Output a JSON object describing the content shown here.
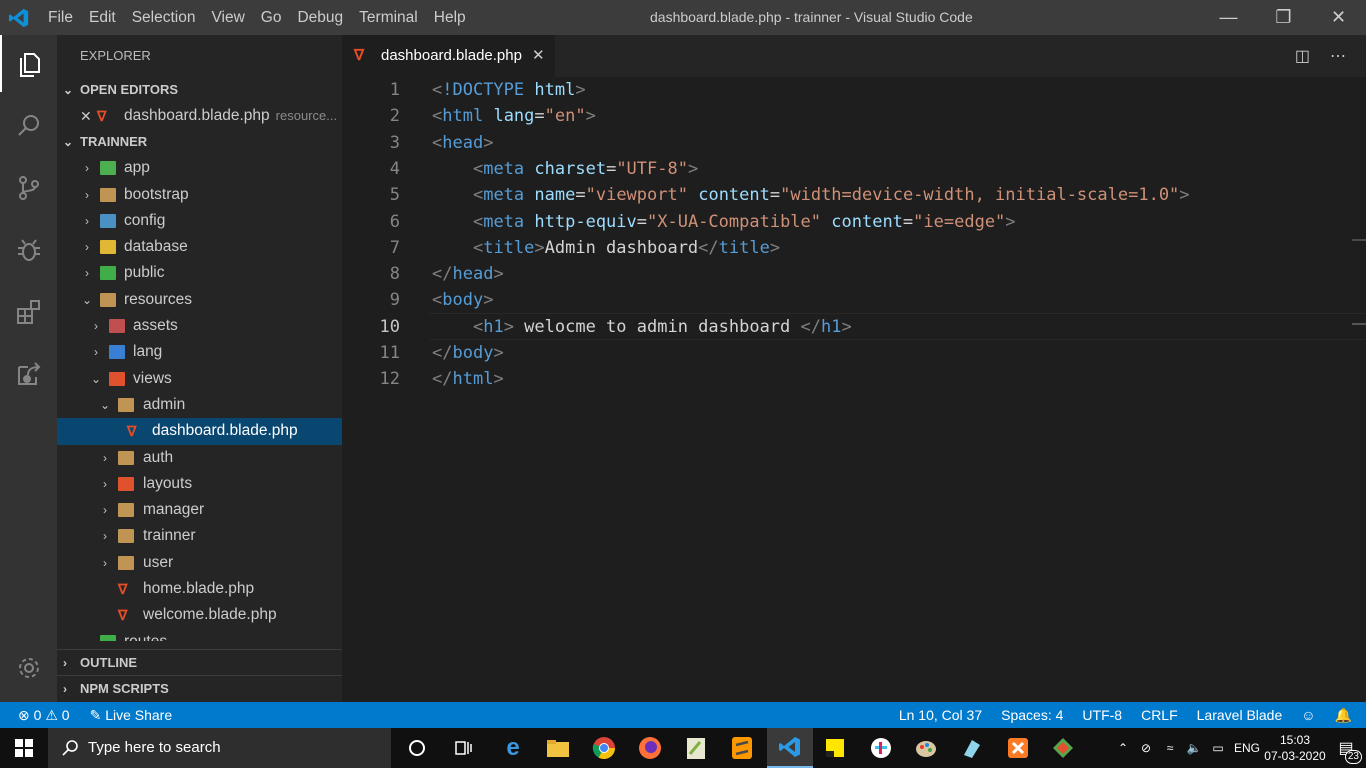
{
  "window": {
    "title": "dashboard.blade.php - trainner - Visual Studio Code",
    "menu": [
      "File",
      "Edit",
      "Selection",
      "View",
      "Go",
      "Debug",
      "Terminal",
      "Help"
    ]
  },
  "explorer": {
    "header": "EXPLORER",
    "open_editors_label": "OPEN EDITORS",
    "open_editor": {
      "name": "dashboard.blade.php",
      "path": "resource..."
    },
    "project_label": "TRAINNER",
    "tree": {
      "app": "app",
      "bootstrap": "bootstrap",
      "config": "config",
      "database": "database",
      "public": "public",
      "resources": "resources",
      "assets": "assets",
      "lang": "lang",
      "views": "views",
      "admin": "admin",
      "dashboard": "dashboard.blade.php",
      "auth": "auth",
      "layouts": "layouts",
      "manager": "manager",
      "trainner": "trainner",
      "user": "user",
      "home": "home.blade.php",
      "welcome": "welcome.blade.php",
      "routes": "routes"
    },
    "outline_label": "OUTLINE",
    "npm_label": "NPM SCRIPTS"
  },
  "editor": {
    "tab": "dashboard.blade.php",
    "line_numbers": [
      "1",
      "2",
      "3",
      "4",
      "5",
      "6",
      "7",
      "8",
      "9",
      "10",
      "11",
      "12"
    ],
    "code": {
      "l1_doctype": "!DOCTYPE",
      "l1_html": "html",
      "html": "html",
      "lang": "lang",
      "lang_val": "\"en\"",
      "head": "head",
      "meta": "meta",
      "charset": "charset",
      "charset_val": "\"UTF-8\"",
      "name": "name",
      "name_val": "\"viewport\"",
      "content": "content",
      "content_val": "\"width=device-width, initial-scale=1.0\"",
      "http_equiv": "http-equiv",
      "http_equiv_val": "\"X-UA-Compatible\"",
      "content_val2": "\"ie=edge\"",
      "title": "title",
      "title_text": "Admin dashboard",
      "body": "body",
      "h1": "h1",
      "h1_text": " welocme to admin dashboard "
    }
  },
  "status": {
    "errors": "0",
    "warnings": "0",
    "live_share": "Live Share",
    "position": "Ln 10, Col 37",
    "spaces": "Spaces: 4",
    "encoding": "UTF-8",
    "eol": "CRLF",
    "language": "Laravel Blade"
  },
  "taskbar": {
    "search_placeholder": "Type here to search",
    "lang": "ENG",
    "time": "15:03",
    "date": "07-03-2020",
    "notifications": "23"
  },
  "colors": {
    "status_bar": "#007acc",
    "selection": "#094771",
    "tag": "#569cd6",
    "attr": "#9cdcfe",
    "string": "#ce9178"
  }
}
